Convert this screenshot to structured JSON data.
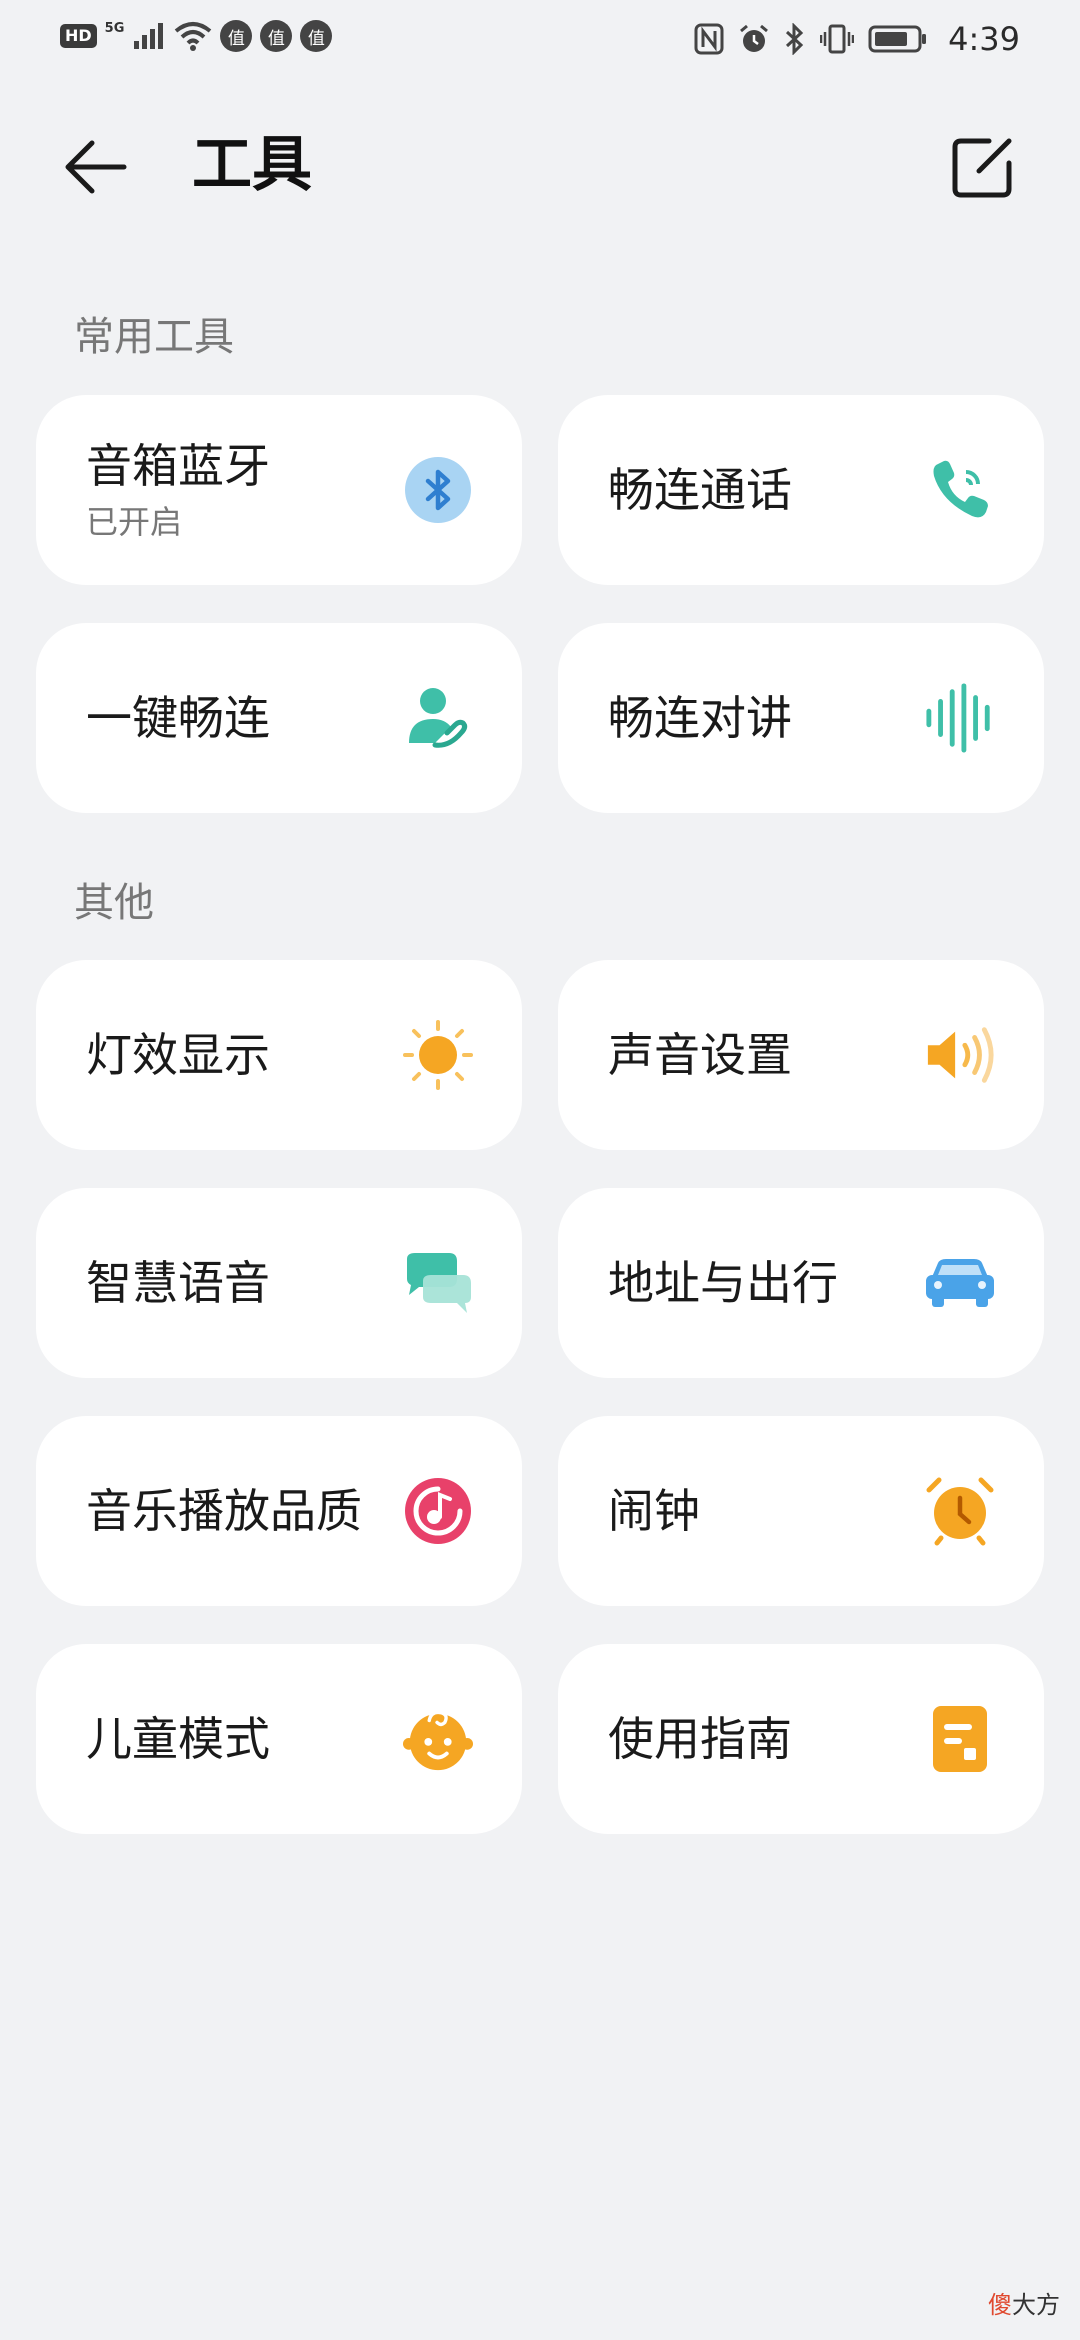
{
  "status_bar": {
    "hd": "HD",
    "network": "5G",
    "badges": [
      "值",
      "值",
      "值"
    ],
    "time": "4:39"
  },
  "header": {
    "title": "工具"
  },
  "sections": [
    {
      "title": "常用工具",
      "items": [
        {
          "label": "音箱蓝牙",
          "sub": "已开启",
          "icon": "bluetooth-icon",
          "color": "#3d8fd9"
        },
        {
          "label": "畅连通话",
          "icon": "phone-icon",
          "color": "#3fbfa8"
        },
        {
          "label": "一键畅连",
          "icon": "person-hand-icon",
          "color": "#3fbfa8"
        },
        {
          "label": "畅连对讲",
          "icon": "soundwave-icon",
          "color": "#3fbfa8"
        }
      ]
    },
    {
      "title": "其他",
      "items": [
        {
          "label": "灯效显示",
          "icon": "sun-icon",
          "color": "#f5a623"
        },
        {
          "label": "声音设置",
          "icon": "speaker-icon",
          "color": "#f5a623"
        },
        {
          "label": "智慧语音",
          "icon": "chat-bubbles-icon",
          "color": "#3fbfa8"
        },
        {
          "label": "地址与出行",
          "icon": "car-icon",
          "color": "#4aa3e8"
        },
        {
          "label": "音乐播放品质",
          "icon": "music-disc-icon",
          "color": "#e8416a"
        },
        {
          "label": "闹钟",
          "icon": "alarm-clock-icon",
          "color": "#f5a623"
        },
        {
          "label": "儿童模式",
          "icon": "baby-face-icon",
          "color": "#f5a623"
        },
        {
          "label": "使用指南",
          "icon": "guide-doc-icon",
          "color": "#f5a623"
        }
      ]
    }
  ],
  "watermark": {
    "first": "傻",
    "rest": "大方"
  }
}
